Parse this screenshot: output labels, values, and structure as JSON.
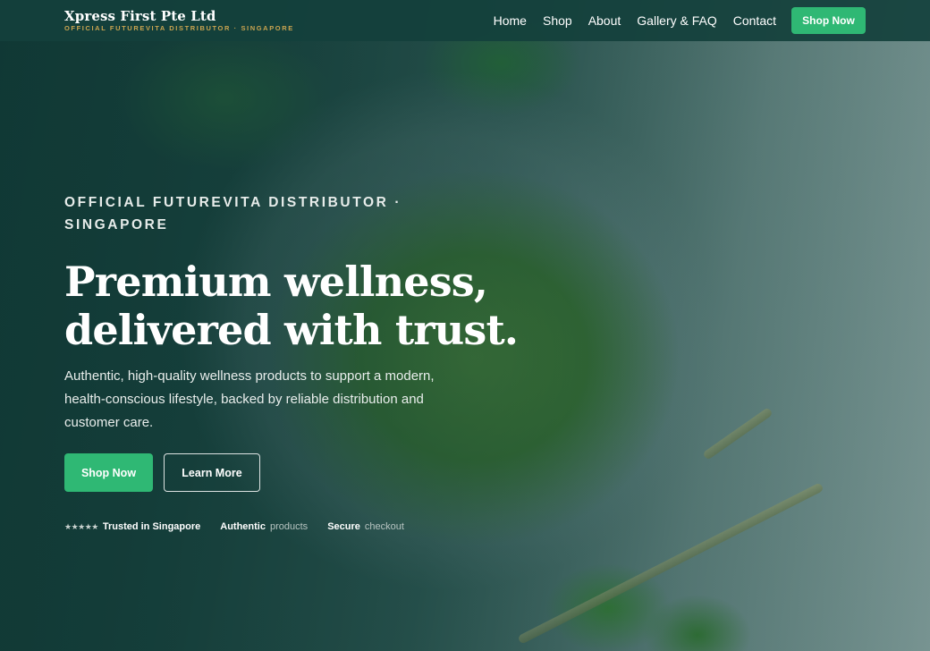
{
  "header": {
    "brand_name": "Xpress First Pte Ltd",
    "brand_tagline": "OFFICIAL FUTUREVITA DISTRIBUTOR · SINGAPORE",
    "nav": [
      {
        "label": "Home"
      },
      {
        "label": "Shop"
      },
      {
        "label": "About"
      },
      {
        "label": "Gallery & FAQ"
      },
      {
        "label": "Contact"
      }
    ],
    "cta_label": "Shop Now"
  },
  "hero": {
    "eyebrow": "OFFICIAL FUTUREVITA DISTRIBUTOR · SINGAPORE",
    "headline": "Premium wellness, delivered with trust.",
    "subtext": "Authentic, high-quality wellness products to support a modern, health-conscious lifestyle, backed by reliable distribution and customer care.",
    "primary_button": "Shop Now",
    "secondary_button": "Learn More",
    "trust": {
      "stars": "★★★★★",
      "item1_strong": "Trusted in Singapore",
      "item2_strong": "Authentic",
      "item2_light": "products",
      "item3_strong": "Secure",
      "item3_light": "checkout"
    }
  },
  "colors": {
    "accent": "#2fb874",
    "header_bg": "#14403c",
    "tagline_gold": "#c9a450"
  }
}
